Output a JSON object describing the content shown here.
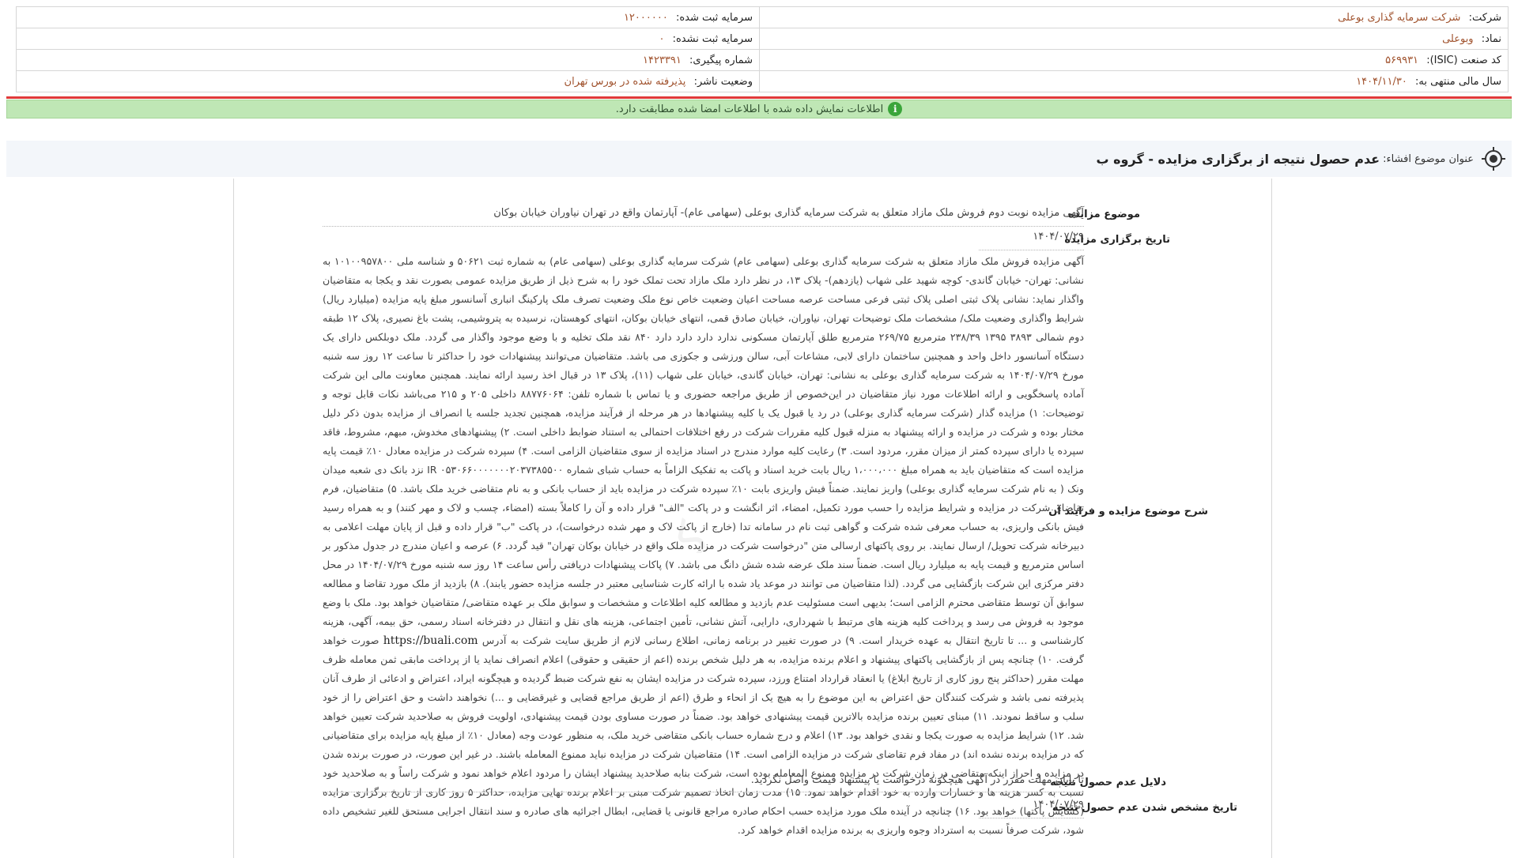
{
  "company": {
    "company_label": "شرکت:",
    "company_value": "شرکت سرمایه گذاری بوعلی",
    "symbol_label": "نماد:",
    "symbol_value": "وبوعلی",
    "isic_label": "کد صنعت (ISIC):",
    "isic_value": "۵۶۹۹۳۱",
    "fiscal_label": "سال مالی منتهی به:",
    "fiscal_value": "۱۴۰۴/۱۱/۳۰",
    "registered_capital_label": "سرمایه ثبت شده:",
    "registered_capital_value": "۱۲۰۰۰۰۰۰",
    "unregistered_capital_label": "سرمایه ثبت نشده:",
    "unregistered_capital_value": "۰",
    "tracking_label": "شماره پیگیری:",
    "tracking_value": "۱۴۲۳۳۹۱",
    "publisher_status_label": "وضعیت ناشر:",
    "publisher_status_value": "پذیرفته شده در بورس تهران"
  },
  "verification": {
    "text": "اطلاعات نمایش داده شده با اطلاعات امضا شده مطابقت دارد.",
    "icon": "info-check-icon",
    "color": "#3aa53a"
  },
  "subject": {
    "label": "عنوان موضوع افشاء:",
    "title": "عدم حصول نتیجه از برگزاری مزایده - گروه ب"
  },
  "fields": {
    "auction_subject_label": "موضوع مزایده",
    "auction_subject_value": "آگهی مزایده نوبت دوم فروش ملک مازاد متعلق به شرکت سرمایه گذاری بوعلی (سهامی عام)- آپارتمان واقع در تهران نیاوران خیابان بوکان",
    "auction_date_label": "تاریخ برگزاری مزایده",
    "auction_date_value": "۱۴۰۴/۰۷/۲۹",
    "description_label": "شرح موضوع مزایده و فرایند آن",
    "description_value": "آگهی مزایده فروش ملک مازاد متعلق به شرکت سرمایه گذاری بوعلی (سهامی عام) شرکت سرمایه گذاری بوعلی (سهامی عام) به شماره ثبت ۵۰۶۲۱ و شناسه ملی ۱۰۱۰۰۹۵۷۸۰۰ به نشانی: تهران- خیابان گاندی- کوچه شهید علی شهاب (یازدهم)- پلاک ۱۳، در نظر دارد ملک مازاد تحت تملک خود را به شرح ذیل از طریق مزایده عمومی بصورت نقد و یکجا به متقاضیان واگذار نماید: نشانی پلاک ثبتی اصلی پلاک ثبتی فرعی مساحت عرصه مساحت اعیان وضعیت خاص نوع ملک وضعیت تصرف ملک پارکینگ انباری آسانسور مبلغ پایه مزایده (میلیارد ریال) شرایط واگذاری وضعیت ملک/ مشخصات ملک توضیحات تهران، نیاوران، خیابان صادق قمی، انتهای خیابان بوکان، انتهای کوهستان، نرسیده به پتروشیمی، پشت باغ نصیری، پلاک ۱۲ طبقه دوم شمالی ۳۸۹۳ ۱۳۹۵ ۲۳۸/۳۹ مترمربع ۲۶۹/۷۵ مترمربع طلق آپارتمان مسکونی ندارد دارد دارد دارد ۸۴۰ نقد ملک تخلیه و با وضع موجود واگذار می گردد. ملک دوبلکس دارای یک دستگاه آسانسور داخل واحد و همچنین ساختمان دارای لابی، مشاعات آبی، سالن ورزشی و جکوزی می باشد. متقاضیان می‌توانند پیشنهادات خود را حداکثر تا ساعت ۱۲ روز سه شنبه مورخ ۱۴۰۴/۰۷/۲۹ به شرکت سرمایه گذاری بوعلی به نشانی: تهران، خیابان گاندی، خیابان علی شهاب (۱۱)، پلاک ۱۳ در قبال اخذ رسید ارائه نمایند. همچنین معاونت مالی این شرکت آماده پاسخگویی و ارائه اطلاعات مورد نیاز متقاضیان در این‌خصوص از طریق مراجعه حضوری و یا تماس با شماره تلفن: ۸۸۷۷۶۰۶۴ داخلی ۲۰۵ و ۲۱۵ می‌باشد نکات قابل توجه و توضیحات: ۱) مزایده گذار (شرکت سرمایه گذاری بوعلی) در رد یا قبول یک یا کلیه پیشنهادها در هر مرحله از فرآیند مزایده، همچنین تجدید جلسه یا انصراف از مزایده بدون ذکر دلیل مختار بوده و شرکت در مزایده و ارائه پیشنهاد به منزله قبول کلیه مقررات شرکت در رفع اختلافات احتمالی به استناد ضوابط داخلی است. ۲) پیشنهادهای مخدوش، مبهم، مشروط، فاقد سپرده یا دارای سپرده کمتر از میزان مقرر، مردود است. ۳) رعایت کلیه موارد مندرج در اسناد مزایده از سوی متقاضیان الزامی است. ۴) سپرده شرکت در مزایده معادل ۱۰٪ قیمت پایه مزایده است که متقاضیان باید به همراه مبلغ ۱،۰۰۰،۰۰۰ ریال بابت خرید اسناد و پاکت به تفکیک الزاماً به حساب شبای شماره ۰۵۳۰۶۶۰۰۰۰۰۰۰۲۰۳۷۳۸۵۵۰۰ IR نزد بانک دی شعبه میدان ونک ( به نام شرکت سرمایه گذاری بوعلی) واریز نمایند. ضمناً فیش واریزی بابت ۱۰٪ سپرده شرکت در مزایده باید از حساب بانکی و به نام متقاضی خرید ملک باشد. ۵) متقاضیان، فرم تقاضای شرکت در مزایده و شرایط مزایده را حسب مورد تکمیل، امضاء، اثر انگشت و در پاکت \"الف\" قرار داده و آن را کاملاً بسته (امضاء، چسب و لاک و مهر کنند) و به همراه رسید فیش بانکی واریزی، به حساب معرفی شده شرکت و گواهی ثبت نام در سامانه تدا (خارج از پاکت لاک و مهر شده درخواست)، در پاکت \"ب\" قرار داده و قبل از پایان مهلت اعلامی به دبیرخانه شرکت تحویل/ ارسال نمایند. بر روی پاکتهای ارسالی متن \"درخواست شرکت در مزایده ملک واقع در خیابان بوکان تهران\" قید گردد. ۶) عرصه و اعیان مندرج در جدول مذکور بر اساس مترمربع و قیمت پایه به میلیارد ریال است. ضمناً سند ملک عرضه شده شش دانگ می باشد. ۷) پاکات پیشنهادات دریافتی رأس ساعت ۱۴ روز سه شنبه مورخ ۱۴۰۴/۰۷/۲۹ در محل دفتر مرکزی این شرکت بازگشایی می گردد. (لذا متقاضیان می توانند در موعد یاد شده با ارائه کارت شناسایی معتبر در جلسه مزایده حضور یابند). ۸) بازدید از ملک مورد تقاضا و مطالعه سوابق آن توسط متقاضی محترم الزامی است؛ بدیهی است مسئولیت عدم بازدید و مطالعه کلیه اطلاعات و مشخصات و سوابق ملک بر عهده متقاضی/ متقاضیان خواهد بود. ملک با وضع موجود به فروش می رسد و پرداخت کلیه هزینه های مرتبط با شهرداری، دارایی، آتش نشانی، تأمین اجتماعی، هزینه های نقل و انتقال در دفترخانه اسناد رسمی، حق بیمه، آگهی، هزینه کارشناسی و ... تا تاریخ انتقال به عهده خریدار است. ۹) در صورت تغییر در برنامه زمانی، اطلاع رسانی لازم از طریق سایت شرکت به آدرس ",
    "description_url": "https://buali.com",
    "description_value_2": " صورت خواهد گرفت. ۱۰) چنانچه پس از بازگشایی پاکتهای پیشنهاد و اعلام برنده مزایده، به هر دلیل شخص برنده (اعم از حقیقی و حقوقی) اعلام انصراف نماید یا از پرداخت مابقی ثمن معامله ظرف مهلت مقرر (حداکثر پنج روز کاری از تاریخ ابلاغ) یا انعقاد قرارداد امتناع ورزد، سپرده شرکت در مزایده ایشان به نفع شرکت ضبط گردیده و هیچگونه ایراد، اعتراض و ادعائی از طرف آنان پذیرفته نمی باشد و شرکت کنندگان حق اعتراض به این موضوع را به هیچ یک از انحاء و طرق (اعم از طریق مراجع قضایی و غیرقضایی و ...) نخواهند داشت و حق اعتراض را از خود سلب و ساقط نمودند. ۱۱) مبنای تعیین برنده مزایده بالاترین قیمت پیشنهادی خواهد بود. ضمناً در صورت مساوی بودن قیمت پیشنهادی، اولویت فروش به صلاحدید شرکت تعیین خواهد شد. ۱۲) شرایط مزایده به صورت یکجا و نقدی خواهد بود. ۱۳) اعلام و درج شماره حساب بانکی متقاضی خرید ملک، به منظور عودت وجه (معادل ۱۰٪ از مبلغ پایه مزایده برای متقاضیانی که در مزایده برنده نشده اند) در مفاد فرم تقاضای شرکت در مزایده الزامی است. ۱۴) متقاضیان شرکت در مزایده نباید ممنوع المعامله باشند. در غیر این صورت، در صورت برنده شدن در مزایده و احراز اینکه متقاضی در زمان شرکت در مزایده ممنوع المعامله بوده است، شرکت بنابه صلاحدید پیشنهاد ایشان را مردود اعلام خواهد نمود و شرکت راساً و به صلاحدید خود نسبت به کسر هزینه ها و خسارات وارده به خود اقدام خواهد نمود. ۱۵) مدت زمان اتخاذ تصمیم شرکت مبنی بر اعلام برنده نهایی مزایده، حداکثر ۵ روز کاری از تاریخ برگزاری مزایده (گشایش پاکتها) خواهد بود. ۱۶) چنانچه در آینده ملک مورد مزایده حسب احکام صادره مراجع قانونی یا قضایی، ابطال اجرائیه های صادره و سند انتقال اجرایی مستحق للغیر تشخیص داده شود، شرکت صرفاً نسبت به استرداد وجوه واریزی به برنده مزایده اقدام خواهد کرد.",
    "no_result_reason_label": "دلایل عدم حصول نتیجه",
    "no_result_reason_value": "تا پایان مهلت مقرر در آگهی هیچگونه درخواست یا پیشنهاد قیمت واصل نگردید.",
    "no_result_date_label": "تاریخ مشخص شدن عدم حصول نتیجه",
    "no_result_date_value": "۱۴۰۴/۰۷/۲۹"
  }
}
